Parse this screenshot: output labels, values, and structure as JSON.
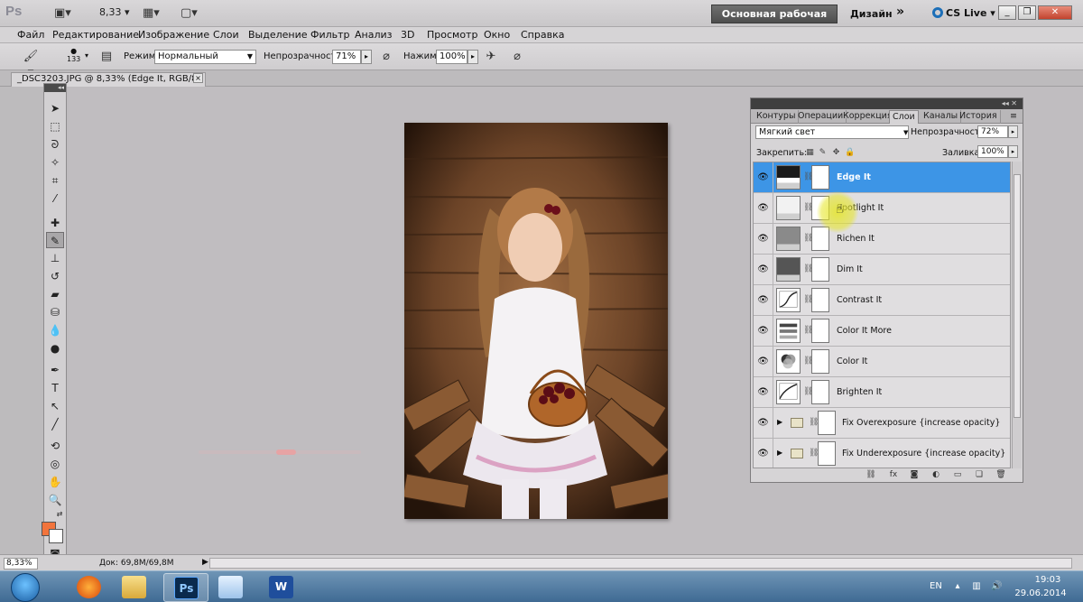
{
  "appbar": {
    "logo": "Ps",
    "zoom": "8,33",
    "workspace_active": "Основная рабочая среда",
    "workspace_design": "Дизайн",
    "more": "»",
    "cslive": "CS Live"
  },
  "menu": [
    "Файл",
    "Редактирование",
    "Изображение",
    "Слои",
    "Выделение",
    "Фильтр",
    "Анализ",
    "3D",
    "Просмотр",
    "Окно",
    "Справка"
  ],
  "options": {
    "brush_size": "133",
    "mode_label": "Режим:",
    "mode_value": "Нормальный",
    "opacity_label": "Непрозрачность:",
    "opacity_value": "71%",
    "flow_label": "Нажим:",
    "flow_value": "100%"
  },
  "document": {
    "tab_title": "_DSC3203.JPG @ 8,33% (Edge It, RGB/8) *",
    "close": "×"
  },
  "status": {
    "zoom": "8,33%",
    "doc": "Док: 69,8M/69,8M",
    "arrow": "▶"
  },
  "layers_panel": {
    "tabs": [
      "Контуры",
      "Операции",
      "Коррекция",
      "Слои",
      "Каналы",
      "История"
    ],
    "active_tab": "Слои",
    "blend_mode": "Мягкий свет",
    "opacity_label": "Непрозрачность:",
    "opacity_value": "72%",
    "lock_label": "Закрепить:",
    "fill_label": "Заливка:",
    "fill_value": "100%",
    "layers": [
      {
        "name": "Edge It",
        "selected": true
      },
      {
        "name": "Spotlight It",
        "selected": false
      },
      {
        "name": "Richen It",
        "selected": false
      },
      {
        "name": "Dim It",
        "selected": false
      },
      {
        "name": "Contrast It",
        "selected": false
      },
      {
        "name": "Color It More",
        "selected": false
      },
      {
        "name": "Color It",
        "selected": false
      },
      {
        "name": "Brighten It",
        "selected": false
      },
      {
        "name": "Fix Overexposure {increase opacity}",
        "group": true
      },
      {
        "name": "Fix Underexposure {increase opacity}",
        "group": true
      }
    ]
  },
  "colors": {
    "foreground": "#f2743c",
    "background": "#ffffff",
    "selection": "#3d95e6"
  },
  "taskbar": {
    "lang": "EN",
    "time": "19:03",
    "date": "29.06.2014",
    "photoshop_label": "Ps",
    "word_label": "W"
  }
}
